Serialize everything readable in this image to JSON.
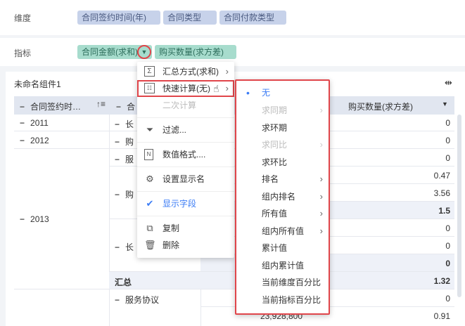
{
  "dimension": {
    "label": "维度",
    "pills": [
      "合同签约时间(年)",
      "合同类型",
      "合同付款类型"
    ]
  },
  "indicator": {
    "label": "指标",
    "pills": [
      "合同金额(求和)",
      "购买数量(求方差)"
    ]
  },
  "component": {
    "title": "未命名组件1",
    "expand_icon": "expand-horizontal-icon"
  },
  "table": {
    "headers": {
      "col1": "合同签约时…",
      "col2": "合",
      "col_last": "购买数量(求方差)"
    },
    "years": [
      "2011",
      "2012",
      "2013"
    ],
    "rows": {
      "r2011_sub": "长",
      "r2012_sub": "购",
      "r2013_a": "服",
      "r2013_b": "购",
      "r2013_c": "长",
      "total": "汇总",
      "service": "服务协议",
      "big_value": "23,928,800"
    },
    "values": [
      "0",
      "0",
      "0",
      "0.47",
      "3.56",
      "1.5",
      "0",
      "0",
      "0",
      "1.32",
      "0",
      "0.91"
    ]
  },
  "context_menu": {
    "items": [
      {
        "icon": "sigma-icon",
        "label": "汇总方式(求和)",
        "arrow": true
      },
      {
        "icon": "calculator-icon",
        "label": "快速计算(无)",
        "arrow": true
      },
      {
        "icon": "",
        "label": "二次计算",
        "disabled": true
      },
      {
        "icon": "filter-icon",
        "label": "过滤..."
      },
      {
        "icon": "number-format-icon",
        "label": "数值格式...."
      },
      {
        "icon": "gear-icon",
        "label": "设置显示名"
      },
      {
        "icon": "check-icon",
        "label": "显示字段",
        "checked": true
      },
      {
        "icon": "copy-icon",
        "label": "复制"
      },
      {
        "icon": "trash-icon",
        "label": "删除"
      }
    ]
  },
  "submenu": {
    "items": [
      {
        "label": "无",
        "selected": true
      },
      {
        "label": "求同期",
        "disabled": true,
        "arrow": true
      },
      {
        "label": "求环期"
      },
      {
        "label": "求同比",
        "disabled": true,
        "arrow": true
      },
      {
        "label": "求环比"
      },
      {
        "label": "排名",
        "arrow": true
      },
      {
        "label": "组内排名",
        "arrow": true
      },
      {
        "label": "所有值",
        "arrow": true
      },
      {
        "label": "组内所有值",
        "arrow": true
      },
      {
        "label": "累计值"
      },
      {
        "label": "组内累计值"
      },
      {
        "label": "当前维度百分比"
      },
      {
        "label": "当前指标百分比"
      }
    ]
  },
  "colors": {
    "accent": "#3b7cf5",
    "highlight_border": "#e0454a"
  }
}
